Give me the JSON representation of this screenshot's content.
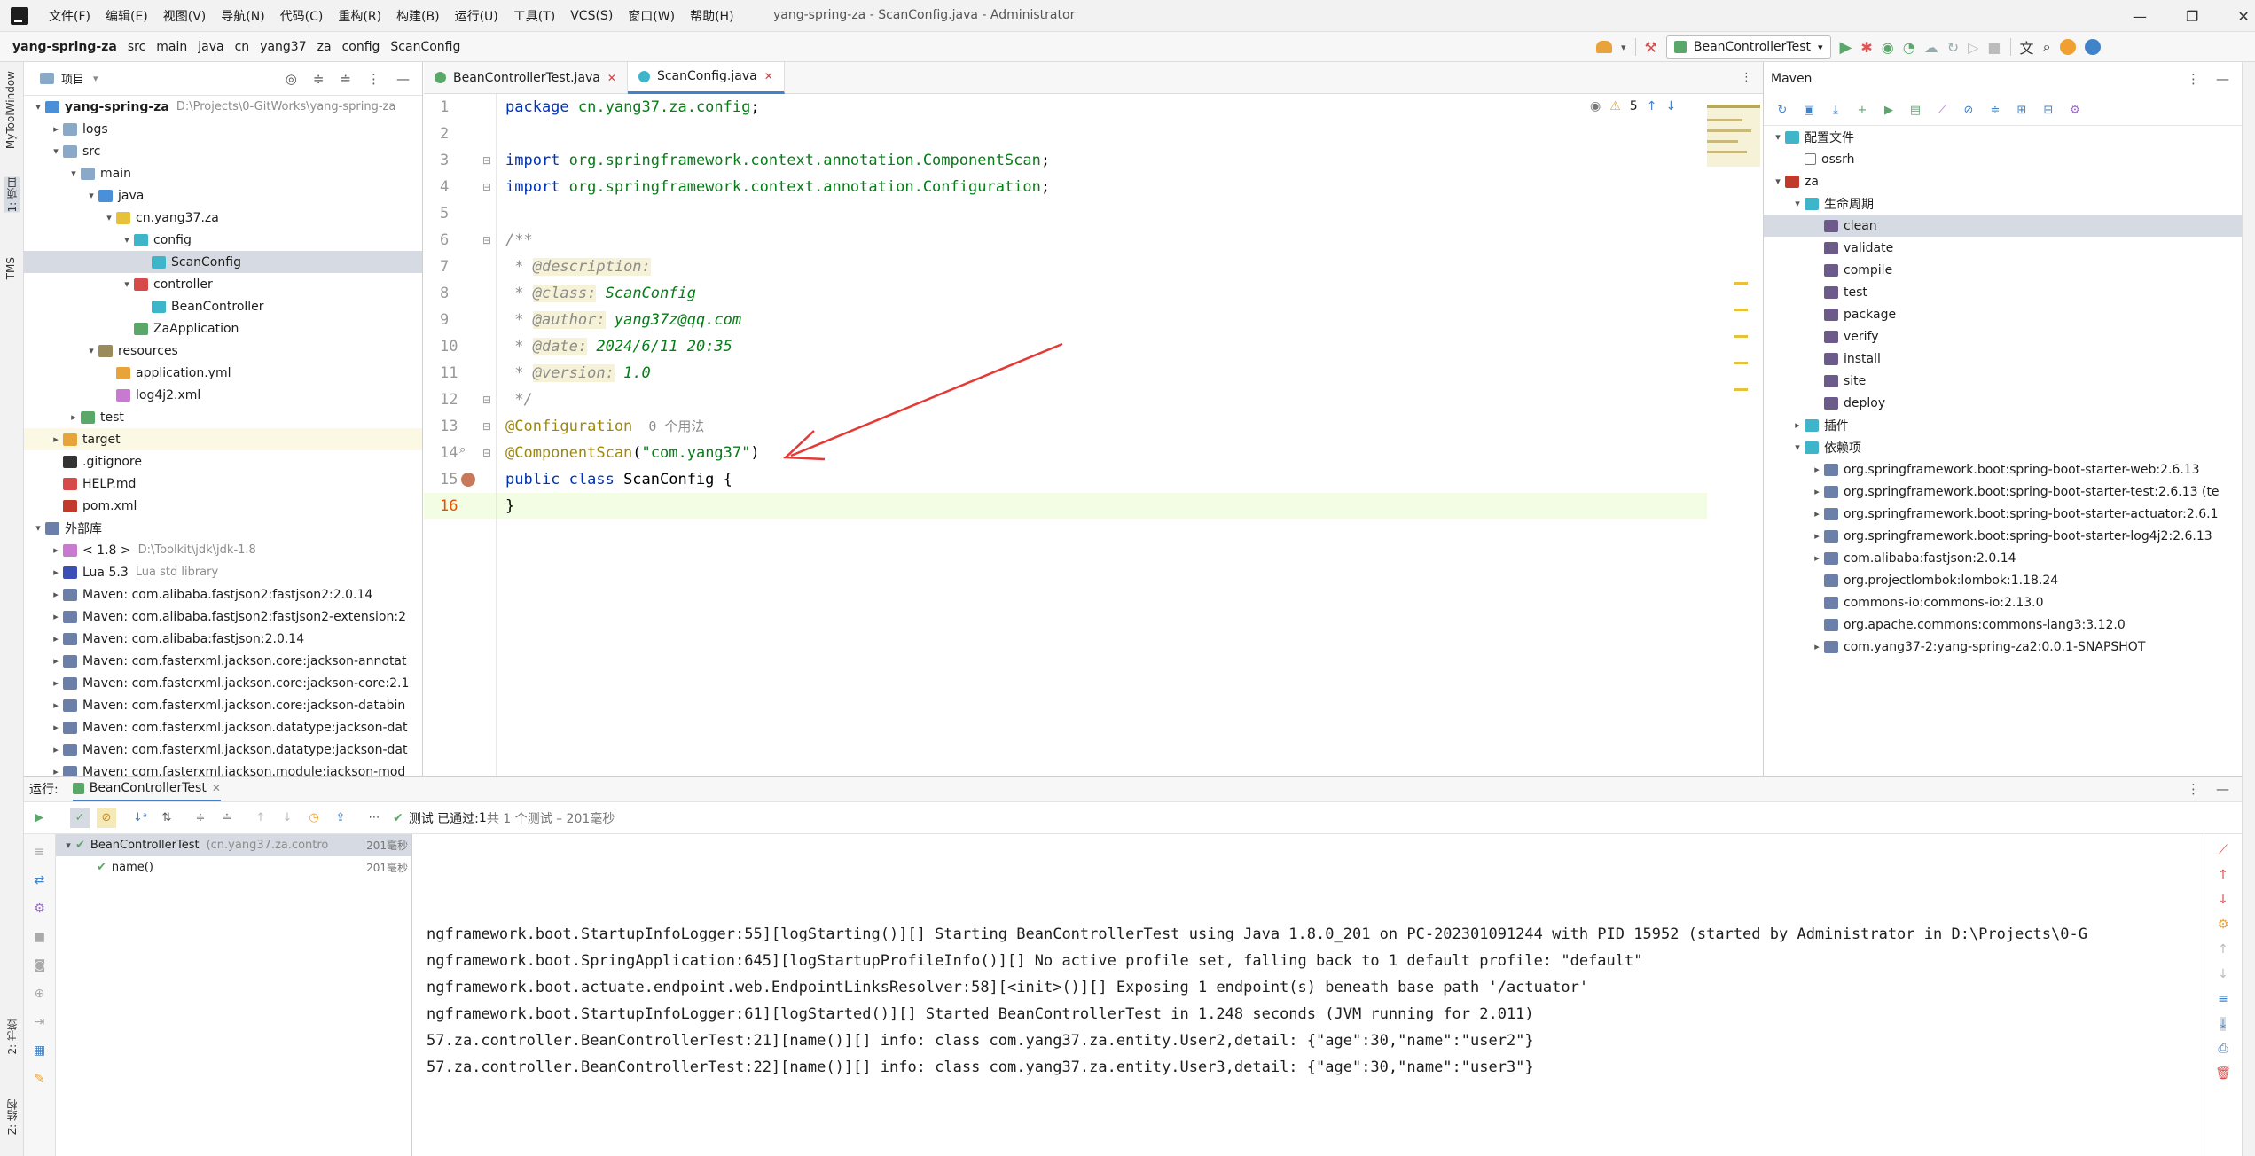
{
  "titlebar": {
    "menu": [
      "文件(F)",
      "编辑(E)",
      "视图(V)",
      "导航(N)",
      "代码(C)",
      "重构(R)",
      "构建(B)",
      "运行(U)",
      "工具(T)",
      "VCS(S)",
      "窗口(W)",
      "帮助(H)"
    ],
    "title": "yang-spring-za - ScanConfig.java - Administrator"
  },
  "navbar": {
    "breadcrumbs": [
      "yang-spring-za",
      "src",
      "main",
      "java",
      "cn",
      "yang37",
      "za",
      "config",
      "ScanConfig"
    ],
    "run_config": "BeanControllerTest"
  },
  "left_strip": {
    "labels": [
      "MyToolWindow",
      "1: 项目",
      "TMS",
      "2: 书签",
      "Z: 结构"
    ]
  },
  "project": {
    "title": "项目",
    "tree": [
      {
        "label": "yang-spring-za",
        "hint": "D:\\Projects\\0-GitWorks\\yang-spring-za",
        "indent": 0,
        "arrow": "▾",
        "icon": "module",
        "bold": true
      },
      {
        "label": "logs",
        "indent": 1,
        "arrow": "▸",
        "icon": "folder"
      },
      {
        "label": "src",
        "indent": 1,
        "arrow": "▾",
        "icon": "folder"
      },
      {
        "label": "main",
        "indent": 2,
        "arrow": "▾",
        "icon": "folder"
      },
      {
        "label": "java",
        "indent": 3,
        "arrow": "▾",
        "icon": "src-folder"
      },
      {
        "label": "cn.yang37.za",
        "indent": 4,
        "arrow": "▾",
        "icon": "package"
      },
      {
        "label": "config",
        "indent": 5,
        "arrow": "▾",
        "icon": "package-cyan"
      },
      {
        "label": "ScanConfig",
        "indent": 6,
        "arrow": "",
        "icon": "class",
        "selected": true
      },
      {
        "label": "controller",
        "indent": 5,
        "arrow": "▾",
        "icon": "package-red"
      },
      {
        "label": "BeanController",
        "indent": 6,
        "arrow": "",
        "icon": "class"
      },
      {
        "label": "ZaApplication",
        "indent": 5,
        "arrow": "",
        "icon": "spring-class"
      },
      {
        "label": "resources",
        "indent": 3,
        "arrow": "▾",
        "icon": "res-folder"
      },
      {
        "label": "application.yml",
        "indent": 4,
        "arrow": "",
        "icon": "yml"
      },
      {
        "label": "log4j2.xml",
        "indent": 4,
        "arrow": "",
        "icon": "xml"
      },
      {
        "label": "test",
        "indent": 2,
        "arrow": "▸",
        "icon": "test-folder"
      },
      {
        "label": "target",
        "indent": 1,
        "arrow": "▸",
        "icon": "target-folder",
        "highlight": true
      },
      {
        "label": ".gitignore",
        "indent": 1,
        "arrow": "",
        "icon": "git"
      },
      {
        "label": "HELP.md",
        "indent": 1,
        "arrow": "",
        "icon": "md"
      },
      {
        "label": "pom.xml",
        "indent": 1,
        "arrow": "",
        "icon": "maven"
      },
      {
        "label": "外部库",
        "indent": 0,
        "arrow": "▾",
        "icon": "lib"
      },
      {
        "label": "< 1.8 >",
        "hint": "D:\\Toolkit\\jdk\\jdk-1.8",
        "indent": 1,
        "arrow": "▸",
        "icon": "jdk"
      },
      {
        "label": "Lua 5.3",
        "hint": "Lua std library",
        "indent": 1,
        "arrow": "▸",
        "icon": "lua"
      },
      {
        "label": "Maven: com.alibaba.fastjson2:fastjson2:2.0.14",
        "indent": 1,
        "arrow": "▸",
        "icon": "lib"
      },
      {
        "label": "Maven: com.alibaba.fastjson2:fastjson2-extension:2",
        "indent": 1,
        "arrow": "▸",
        "icon": "lib"
      },
      {
        "label": "Maven: com.alibaba:fastjson:2.0.14",
        "indent": 1,
        "arrow": "▸",
        "icon": "lib"
      },
      {
        "label": "Maven: com.fasterxml.jackson.core:jackson-annotat",
        "indent": 1,
        "arrow": "▸",
        "icon": "lib"
      },
      {
        "label": "Maven: com.fasterxml.jackson.core:jackson-core:2.1",
        "indent": 1,
        "arrow": "▸",
        "icon": "lib"
      },
      {
        "label": "Maven: com.fasterxml.jackson.core:jackson-databin",
        "indent": 1,
        "arrow": "▸",
        "icon": "lib"
      },
      {
        "label": "Maven: com.fasterxml.jackson.datatype:jackson-dat",
        "indent": 1,
        "arrow": "▸",
        "icon": "lib"
      },
      {
        "label": "Maven: com.fasterxml.jackson.datatype:jackson-dat",
        "indent": 1,
        "arrow": "▸",
        "icon": "lib"
      },
      {
        "label": "Maven: com.fasterxml.jackson.module:jackson-mod",
        "indent": 1,
        "arrow": "▸",
        "icon": "lib"
      }
    ]
  },
  "editor": {
    "tabs": [
      {
        "label": "BeanControllerTest.java",
        "active": false
      },
      {
        "label": "ScanConfig.java",
        "active": true
      }
    ],
    "warnings": "5",
    "line_numbers": [
      "1",
      "2",
      "3",
      "4",
      "5",
      "6",
      "7",
      "8",
      "9",
      "10",
      "11",
      "12",
      "13",
      "14",
      "15",
      "16"
    ],
    "lines": [
      {
        "parts": [
          [
            "kw",
            "package "
          ],
          [
            "pk",
            "cn.yang37.za.config"
          ],
          [
            "cls",
            ";"
          ]
        ]
      },
      {
        "parts": []
      },
      {
        "parts": [
          [
            "kw",
            "import "
          ],
          [
            "pk",
            "org.springframework.context.annotation.ComponentScan"
          ],
          [
            "cls",
            ";"
          ]
        ]
      },
      {
        "parts": [
          [
            "kw",
            "import "
          ],
          [
            "pk",
            "org.springframework.context.annotation.Configuration"
          ],
          [
            "cls",
            ";"
          ]
        ]
      },
      {
        "parts": []
      },
      {
        "parts": [
          [
            "cm",
            "/**"
          ]
        ]
      },
      {
        "parts": [
          [
            "cm",
            " * "
          ],
          [
            "doctag",
            "@description:"
          ]
        ]
      },
      {
        "parts": [
          [
            "cm",
            " * "
          ],
          [
            "doctag",
            "@class:"
          ],
          [
            "docval",
            " ScanConfig"
          ]
        ]
      },
      {
        "parts": [
          [
            "cm",
            " * "
          ],
          [
            "doctag",
            "@author:"
          ],
          [
            "docval",
            " yang37z@qq.com"
          ]
        ]
      },
      {
        "parts": [
          [
            "cm",
            " * "
          ],
          [
            "doctag",
            "@date:"
          ],
          [
            "docval",
            " 2024/6/11 20:35"
          ]
        ]
      },
      {
        "parts": [
          [
            "cm",
            " * "
          ],
          [
            "doctag",
            "@version:"
          ],
          [
            "docval",
            " 1.0"
          ]
        ]
      },
      {
        "parts": [
          [
            "cm",
            " */"
          ]
        ]
      },
      {
        "parts": [
          [
            "ann",
            "@Configuration"
          ],
          [
            "hint",
            "  0 个用法"
          ]
        ]
      },
      {
        "parts": [
          [
            "ann",
            "@ComponentScan"
          ],
          [
            "cls",
            "("
          ],
          [
            "str",
            "\"com.yang37\""
          ],
          [
            "cls",
            ")"
          ]
        ]
      },
      {
        "parts": [
          [
            "kw",
            "public class "
          ],
          [
            "cls",
            "ScanConfig "
          ],
          [
            "cls",
            "{"
          ]
        ]
      },
      {
        "parts": [
          [
            "cls",
            "}"
          ]
        ]
      }
    ]
  },
  "maven": {
    "title": "Maven",
    "tree": [
      {
        "label": "配置文件",
        "indent": 0,
        "arrow": "▾",
        "icon": "folder-cyan"
      },
      {
        "label": "ossrh",
        "indent": 1,
        "arrow": "",
        "icon": "checkbox"
      },
      {
        "label": "za",
        "indent": 0,
        "arrow": "▾",
        "icon": "maven"
      },
      {
        "label": "生命周期",
        "indent": 1,
        "arrow": "▾",
        "icon": "folder-cyan"
      },
      {
        "label": "clean",
        "indent": 2,
        "arrow": "",
        "icon": "goal",
        "selected": true
      },
      {
        "label": "validate",
        "indent": 2,
        "arrow": "",
        "icon": "goal"
      },
      {
        "label": "compile",
        "indent": 2,
        "arrow": "",
        "icon": "goal"
      },
      {
        "label": "test",
        "indent": 2,
        "arrow": "",
        "icon": "goal"
      },
      {
        "label": "package",
        "indent": 2,
        "arrow": "",
        "icon": "goal"
      },
      {
        "label": "verify",
        "indent": 2,
        "arrow": "",
        "icon": "goal"
      },
      {
        "label": "install",
        "indent": 2,
        "arrow": "",
        "icon": "goal"
      },
      {
        "label": "site",
        "indent": 2,
        "arrow": "",
        "icon": "goal"
      },
      {
        "label": "deploy",
        "indent": 2,
        "arrow": "",
        "icon": "goal"
      },
      {
        "label": "插件",
        "indent": 1,
        "arrow": "▸",
        "icon": "folder-cyan"
      },
      {
        "label": "依赖项",
        "indent": 1,
        "arrow": "▾",
        "icon": "folder-cyan"
      },
      {
        "label": "org.springframework.boot:spring-boot-starter-web:2.6.13",
        "indent": 2,
        "arrow": "▸",
        "icon": "dep"
      },
      {
        "label": "org.springframework.boot:spring-boot-starter-test:2.6.13 (te",
        "indent": 2,
        "arrow": "▸",
        "icon": "dep"
      },
      {
        "label": "org.springframework.boot:spring-boot-starter-actuator:2.6.1",
        "indent": 2,
        "arrow": "▸",
        "icon": "dep"
      },
      {
        "label": "org.springframework.boot:spring-boot-starter-log4j2:2.6.13",
        "indent": 2,
        "arrow": "▸",
        "icon": "dep"
      },
      {
        "label": "com.alibaba:fastjson:2.0.14",
        "indent": 2,
        "arrow": "▸",
        "icon": "dep"
      },
      {
        "label": "org.projectlombok:lombok:1.18.24",
        "indent": 2,
        "arrow": "",
        "icon": "dep"
      },
      {
        "label": "commons-io:commons-io:2.13.0",
        "indent": 2,
        "arrow": "",
        "icon": "dep"
      },
      {
        "label": "org.apache.commons:commons-lang3:3.12.0",
        "indent": 2,
        "arrow": "",
        "icon": "dep"
      },
      {
        "label": "com.yang37-2:yang-spring-za2:0.0.1-SNAPSHOT",
        "indent": 2,
        "arrow": "▸",
        "icon": "dep"
      }
    ]
  },
  "run": {
    "label": "运行:",
    "tab": "BeanControllerTest",
    "status_prefix": "测试 已通过:",
    "status_count": "1",
    "status_suffix": "共 1 个测试 – 201毫秒",
    "tests": [
      {
        "name": "BeanControllerTest",
        "hint": "(cn.yang37.za.contro",
        "time": "201毫秒",
        "indent": 0
      },
      {
        "name": "name()",
        "hint": "",
        "time": "201毫秒",
        "indent": 1
      }
    ],
    "console": [
      "ngframework.boot.StartupInfoLogger:55][logStarting()][] Starting BeanControllerTest using Java 1.8.0_201 on PC-202301091244 with PID 15952 (started by Administrator in D:\\Projects\\0-G",
      "ngframework.boot.SpringApplication:645][logStartupProfileInfo()][] No active profile set, falling back to 1 default profile: \"default\"",
      "ngframework.boot.actuate.endpoint.web.EndpointLinksResolver:58][<init>()][] Exposing 1 endpoint(s) beneath base path '/actuator'",
      "ngframework.boot.StartupInfoLogger:61][logStarted()][] Started BeanControllerTest in 1.248 seconds (JVM running for 2.011)",
      "57.za.controller.BeanControllerTest:21][name()][] info: class com.yang37.za.entity.User2,detail: {\"age\":30,\"name\":\"user2\"}",
      "57.za.controller.BeanControllerTest:22][name()][] info: class com.yang37.za.entity.User3,detail: {\"age\":30,\"name\":\"user3\"}"
    ]
  },
  "colors": {
    "accent": "#4083c9",
    "annotation_arrow": "#e53935",
    "run_green": "#59a869",
    "debug_red": "#e05555"
  }
}
